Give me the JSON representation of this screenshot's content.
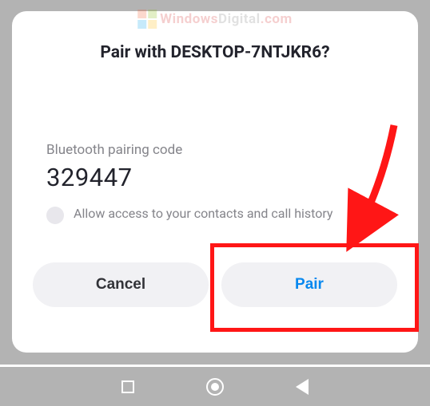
{
  "dialog": {
    "title": "Pair with DESKTOP-7NTJKR6?",
    "code_label": "Bluetooth pairing code",
    "code": "329447",
    "checkbox_label": "Allow access to your contacts and call history",
    "cancel": "Cancel",
    "pair": "Pair"
  },
  "watermark": {
    "part1": "Windows",
    "part2": "Digital",
    "part3": ".com"
  }
}
